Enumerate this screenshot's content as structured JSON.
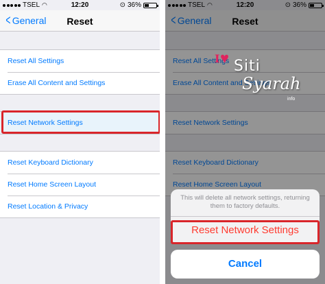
{
  "left_screen": {
    "status": {
      "carrier": "TSEL",
      "time": "12:20",
      "battery": "36%"
    },
    "nav": {
      "back_label": "General",
      "title": "Reset"
    },
    "group1": [
      "Reset All Settings",
      "Erase All Content and Settings"
    ],
    "group2": [
      "Reset Network Settings"
    ],
    "group3": [
      "Reset Keyboard Dictionary",
      "Reset Home Screen Layout",
      "Reset Location & Privacy"
    ]
  },
  "right_screen": {
    "status": {
      "carrier": "TSEL",
      "time": "12:20",
      "battery": "36%"
    },
    "nav": {
      "back_label": "General",
      "title": "Reset"
    },
    "group1": [
      "Reset All Settings",
      "Erase All Content and Settings"
    ],
    "group2": [
      "Reset Network Settings"
    ],
    "group3": [
      "Reset Keyboard Dictionary",
      "Reset Home Screen Layout"
    ],
    "action_sheet": {
      "message": "This will delete all network settings, returning them to factory defaults.",
      "confirm_label": "Reset Network Settings",
      "cancel_label": "Cancel"
    }
  },
  "watermark": {
    "line1": "Siti",
    "line2": "Syarah",
    "line3": "info",
    "i": "I"
  },
  "colors": {
    "accent": "#007aff",
    "destructive": "#ff3b30",
    "highlight_border": "#d9252a"
  }
}
